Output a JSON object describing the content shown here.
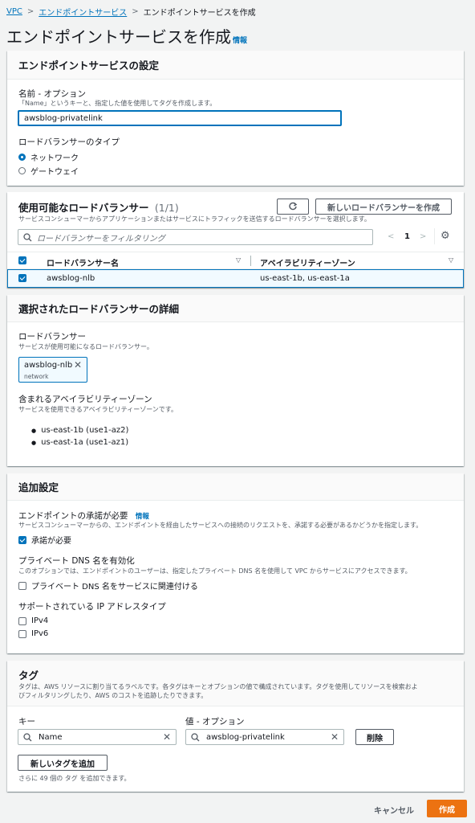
{
  "breadcrumb": {
    "items": [
      "VPC",
      "エンドポイントサービス",
      "エンドポイントサービスを作成"
    ]
  },
  "page": {
    "title": "エンドポイントサービスを作成",
    "info": "情報"
  },
  "settings": {
    "heading": "エンドポイントサービスの設定",
    "name_label": "名前 - オプション",
    "name_desc": "「Name」というキーと、指定した値を使用してタグを作成します。",
    "name_value": "awsblog-privatelink",
    "lb_type_label": "ロードバランサーのタイプ",
    "lb_type_options": [
      "ネットワーク",
      "ゲートウェイ"
    ],
    "lb_type_selected": "ネットワーク"
  },
  "available_lbs": {
    "heading": "使用可能なロードバランサー",
    "count": "(1/1)",
    "desc": "サービスコンシューマーからアプリケーションまたはサービスにトラフィックを送信するロードバランサーを選択します。",
    "create_button": "新しいロードバランサーを作成",
    "filter_placeholder": "ロードバランサーをフィルタリング",
    "page": "1",
    "columns": [
      "ロードバランサー名",
      "アベイラビリティーゾーン"
    ],
    "rows": [
      {
        "name": "awsblog-nlb",
        "zones": "us-east-1b, us-east-1a",
        "selected": true
      }
    ]
  },
  "selected_details": {
    "heading": "選択されたロードバランサーの詳細",
    "lb_label": "ロードバランサー",
    "lb_desc": "サービスが使用可能になるロードバランサー。",
    "token_name": "awsblog-nlb",
    "token_type": "network",
    "az_label": "含まれるアベイラビリティーゾーン",
    "az_desc": "サービスを使用できるアベイラビリティーゾーンです。",
    "zones": [
      "us-east-1b (use1-az2)",
      "us-east-1a (use1-az1)"
    ]
  },
  "additional": {
    "heading": "追加設定",
    "accept_label": "エンドポイントの承諾が必要",
    "accept_info": "情報",
    "accept_desc": "サービスコンシューマーからの、エンドポイントを経由したサービスへの接続のリクエストを、承諾する必要があるかどうかを指定します。",
    "accept_checkbox": "承諾が必要",
    "accept_checked": true,
    "dns_label": "プライベート DNS 名を有効化",
    "dns_desc": "このオプションでは、エンドポイントのユーザーは、指定したプライベート DNS 名を使用して VPC からサービスにアクセスできます。",
    "dns_checkbox": "プライベート DNS 名をサービスに関連付ける",
    "ip_label": "サポートされている IP アドレスタイプ",
    "ip_options": [
      "IPv4",
      "IPv6"
    ]
  },
  "tags": {
    "heading": "タグ",
    "desc1": "タグは、AWS リソースに割り当てるラベルです。各タグはキーとオプションの値で構成されています。タグを使用してリソースを検索およ",
    "desc2": "びフィルタリングしたり、AWS のコストを追跡したりできます。",
    "key_label": "キー",
    "value_label": "値 - オプション",
    "key_value": "Name",
    "value_value": "awsblog-privatelink",
    "remove_button": "削除",
    "add_button": "新しいタグを追加",
    "hint": "さらに 49 個の タグ を追加できます。"
  },
  "footer": {
    "cancel": "キャンセル",
    "create": "作成"
  },
  "colors": {
    "primary": "#ec7211",
    "link": "#0073bb",
    "selected_row": "#f1faff"
  }
}
